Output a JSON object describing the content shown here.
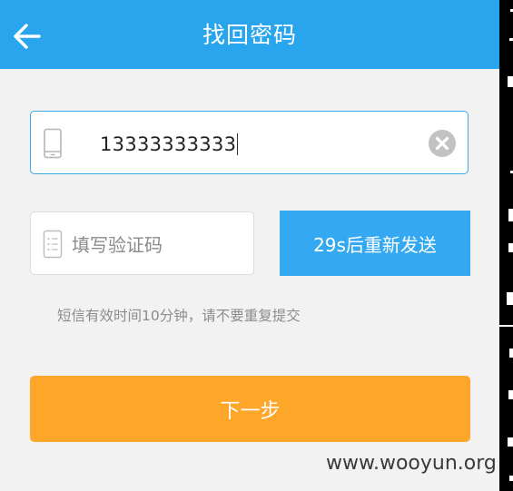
{
  "header": {
    "title": "找回密码",
    "back_icon": "arrow-left-icon",
    "bg_color": "#29a5ee"
  },
  "phone": {
    "icon": "mobile-phone-icon",
    "value": "13333333333",
    "clear_icon": "clear-x-icon"
  },
  "code": {
    "icon": "document-icon",
    "placeholder": "填写验证码"
  },
  "resend": {
    "label": "29s后重新发送",
    "color": "#34a8f0"
  },
  "hint": "短信有效时间10分钟，请不要重复提交",
  "next": {
    "label": "下一步",
    "color": "#fda62a"
  },
  "watermark": "www.wooyun.org"
}
